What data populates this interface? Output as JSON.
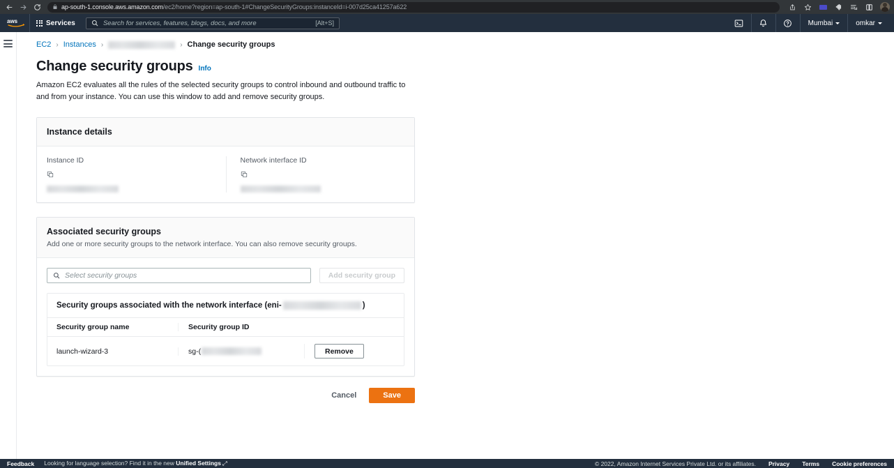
{
  "browser": {
    "back_icon": "back-arrow-icon",
    "forward_icon": "forward-arrow-icon",
    "reload_icon": "reload-icon",
    "lock_icon": "lock-icon",
    "url_domain": "ap-south-1.console.aws.amazon.com",
    "url_path": "/ec2/home?region=ap-south-1#ChangeSecurityGroups:instanceId=i-007d25ca41257a622",
    "toolbar_icons": [
      "share-icon",
      "bookmark-star-icon",
      "extension-badge-icon",
      "extensions-puzzle-icon",
      "reading-list-icon",
      "split-view-icon",
      "profile-avatar"
    ]
  },
  "awsnav": {
    "logo": "aws-logo",
    "services_label": "Services",
    "services_icon": "grid-menu-icon",
    "search_placeholder": "Search for services, features, blogs, docs, and more",
    "search_shortcut": "[Alt+S]",
    "search_icon": "search-icon",
    "cloudshell_icon": "cloudshell-icon",
    "bell_icon": "notifications-bell-icon",
    "help_icon": "help-circle-icon",
    "region_label": "Mumbai",
    "account_label": "omkar"
  },
  "sidebar": {
    "menu_icon": "hamburger-menu-icon"
  },
  "breadcrumb": {
    "items": [
      {
        "label": "EC2",
        "type": "link"
      },
      {
        "label": "Instances",
        "type": "link"
      },
      {
        "label": "",
        "type": "redacted"
      },
      {
        "label": "Change security groups",
        "type": "current"
      }
    ],
    "separator": "›"
  },
  "header": {
    "title": "Change security groups",
    "info_label": "Info",
    "description": "Amazon EC2 evaluates all the rules of the selected security groups to control inbound and outbound traffic to and from your instance. You can use this window to add and remove security groups."
  },
  "instance_details": {
    "card_title": "Instance details",
    "fields": [
      {
        "label": "Instance ID",
        "value": "",
        "copy_icon": "copy-icon"
      },
      {
        "label": "Network interface ID",
        "value": "",
        "copy_icon": "copy-icon"
      }
    ]
  },
  "associated": {
    "card_title": "Associated security groups",
    "card_subtitle": "Add one or more security groups to the network interface. You can also remove security groups.",
    "search_placeholder": "Select security groups",
    "search_icon": "search-icon",
    "add_button_label": "Add security group",
    "add_button_disabled": true,
    "table": {
      "title_prefix": "Security groups associated with the network interface (eni-",
      "title_suffix": ")",
      "columns": [
        "Security group name",
        "Security group ID"
      ],
      "rows": [
        {
          "name": "launch-wizard-3",
          "id_prefix": "sg-(",
          "remove_label": "Remove"
        }
      ]
    }
  },
  "actions": {
    "cancel_label": "Cancel",
    "save_label": "Save",
    "save_color": "#ec7211"
  },
  "footer": {
    "feedback_label": "Feedback",
    "language_text": "Looking for language selection? Find it in the new",
    "language_link": "Unified Settings",
    "external_icon": "external-link-icon",
    "copyright": "© 2022, Amazon Internet Services Private Ltd. or its affiliates.",
    "links": [
      "Privacy",
      "Terms",
      "Cookie preferences"
    ]
  }
}
